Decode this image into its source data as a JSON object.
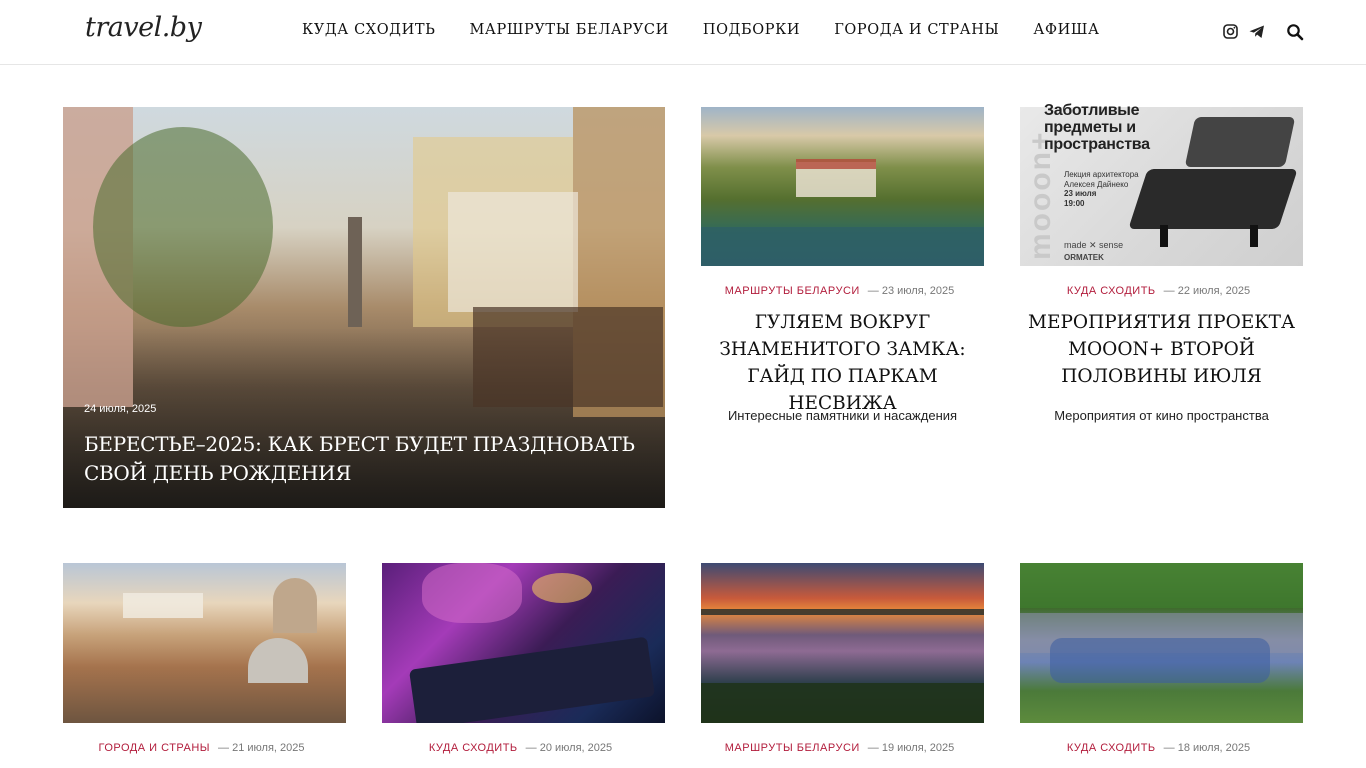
{
  "header": {
    "logo": "travel.by",
    "nav": [
      {
        "label": "КУДА СХОДИТЬ"
      },
      {
        "label": "МАРШРУТЫ БЕЛАРУСИ"
      },
      {
        "label": "ПОДБОРКИ"
      },
      {
        "label": "ГОРОДА И СТРАНЫ"
      },
      {
        "label": "АФИША"
      }
    ],
    "icons": [
      "instagram-icon",
      "telegram-icon",
      "search-icon"
    ]
  },
  "hero": {
    "date": "24 июля, 2025",
    "title": "БЕРЕСТЬЕ–2025: КАК БРЕСТ БУДЕТ ПРАЗДНОВАТЬ СВОЙ ДЕНЬ РОЖДЕНИЯ"
  },
  "cards_top": [
    {
      "category": "МАРШРУТЫ БЕЛАРУСИ",
      "date": "— 23 июля, 2025",
      "title": "ГУЛЯЕМ ВОКРУГ ЗНАМЕНИТОГО ЗАМКА: ГАЙД ПО ПАРКАМ НЕСВИЖА",
      "desc": "Интересные памятники и насаждения"
    },
    {
      "category": "КУДА СХОДИТЬ",
      "date": "— 22 июля, 2025",
      "title": "МЕРОПРИЯТИЯ ПРОЕКТА MOOON+ ВТОРОЙ ПОЛОВИНЫ ИЮЛЯ",
      "desc": "Мероприятия от кино пространства"
    }
  ],
  "poster": {
    "title": "Заботливые предметы и пространства",
    "lecture": "Лекция архитектора Алексея Дайнеко",
    "date": "23 июля 19:00",
    "vertical": "mooon+",
    "brand": "made ✕ sense",
    "brand2": "ORMATEK"
  },
  "cards_bottom": [
    {
      "category": "ГОРОДА И СТРАНЫ",
      "date": "— 21 июля, 2025"
    },
    {
      "category": "КУДА СХОДИТЬ",
      "date": "— 20 июля, 2025"
    },
    {
      "category": "МАРШРУТЫ БЕЛАРУСИ",
      "date": "— 19 июля, 2025"
    },
    {
      "category": "КУДА СХОДИТЬ",
      "date": "— 18 июля, 2025"
    }
  ],
  "colors": {
    "accent": "#b21d3c",
    "text": "#111111",
    "border": "#e6e6e6"
  }
}
